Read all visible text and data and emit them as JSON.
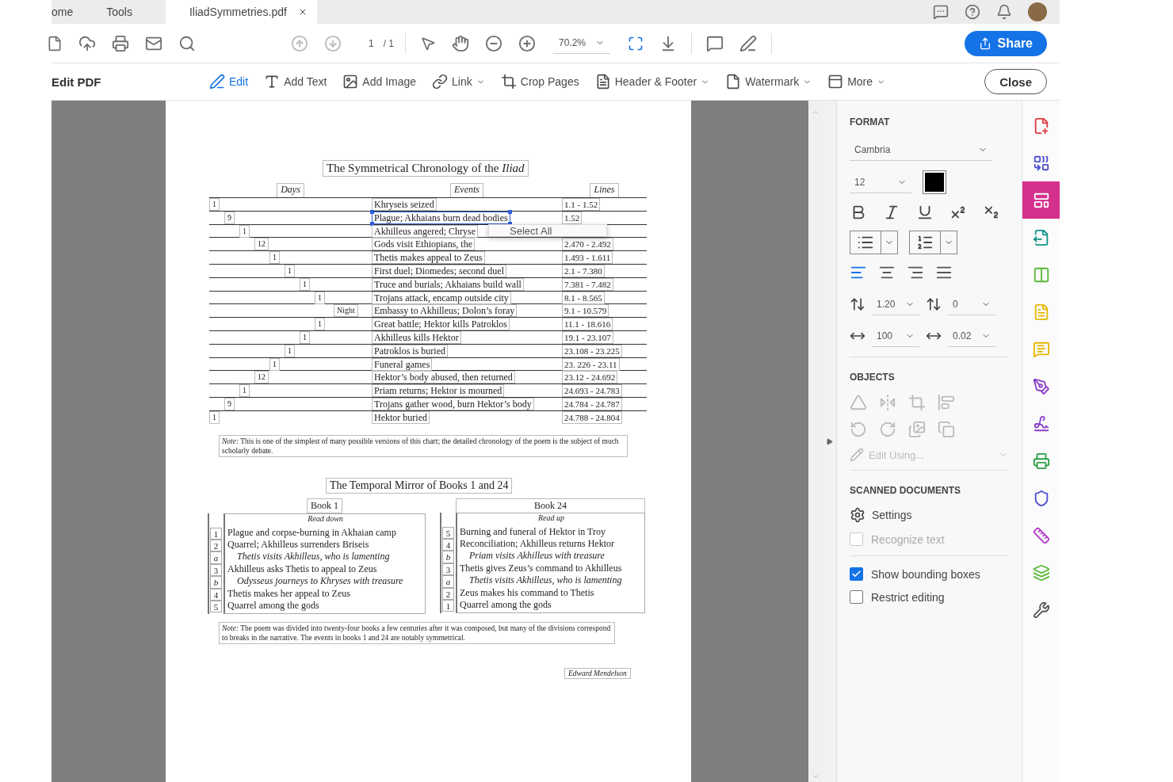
{
  "tabs": [
    {
      "label": "ome",
      "selected": false,
      "closable": false
    },
    {
      "label": "Tools",
      "selected": false,
      "closable": false
    },
    {
      "label": "IliadSymmetries.pdf",
      "selected": true,
      "closable": true
    }
  ],
  "toolbar": {
    "page_current": "1",
    "page_total": "/ 1",
    "zoom": "70.2%",
    "share": "Share"
  },
  "edit_bar": {
    "title": "Edit PDF",
    "tools": [
      {
        "kind": "edit",
        "label": "Edit",
        "selected": true,
        "dropdown": false
      },
      {
        "kind": "text",
        "label": "Add Text",
        "selected": false,
        "dropdown": false
      },
      {
        "kind": "image",
        "label": "Add Image",
        "selected": false,
        "dropdown": false
      },
      {
        "kind": "link",
        "label": "Link",
        "selected": false,
        "dropdown": true
      },
      {
        "kind": "crop",
        "label": "Crop Pages",
        "selected": false,
        "dropdown": false
      },
      {
        "kind": "header",
        "label": "Header & Footer",
        "selected": false,
        "dropdown": true
      },
      {
        "kind": "watermark",
        "label": "Watermark",
        "selected": false,
        "dropdown": true
      },
      {
        "kind": "more",
        "label": "More",
        "selected": false,
        "dropdown": true
      }
    ],
    "close": "Close"
  },
  "document": {
    "title": "The Symmetrical Chronology of the *Iliad*",
    "headers": [
      "Days",
      "Events",
      "Lines"
    ],
    "rows": [
      {
        "days": "1",
        "event": "Khryseis seized",
        "lines": "1.1 - 1.52",
        "selected": false
      },
      {
        "days": "9",
        "event": "Plague; Akhaians burn dead bodies",
        "lines": "1.52",
        "selected": true
      },
      {
        "days": "1",
        "event": "Akhilleus angered; Chryse",
        "selected": false
      },
      {
        "days": "12",
        "event": "Gods visit Ethiopians, the",
        "lines": "2.470 - 2.492",
        "selected": false
      },
      {
        "days": "1",
        "event": "Thetis makes appeal to Zeus",
        "lines": "1.493 - 1.611",
        "selected": false
      },
      {
        "days": "1",
        "event": "First duel; Diomedes; second duel",
        "lines": "2.1 - 7.380",
        "selected": false
      },
      {
        "days": "1",
        "event": "Truce and burials; Akhaians build wall",
        "lines": "7.381 - 7.482",
        "selected": false
      },
      {
        "days": "1",
        "event": "Trojans attack, encamp outside city",
        "lines": "8.1 - 8.565",
        "selected": false
      },
      {
        "days": "Night",
        "event": "Embassy to Akhilleus; Dolon’s foray",
        "lines": "9.1 - 10.579",
        "selected": false
      },
      {
        "days": "1",
        "event": "Great battle; Hektor kills Patroklos",
        "lines": "11.1 - 18.616",
        "selected": false
      },
      {
        "days": "1",
        "event": "Akhilleus kills Hektor",
        "lines": "19.1 - 23.107",
        "selected": false
      },
      {
        "days": "1",
        "event": "Patroklos is buried",
        "lines": "23.108 - 23.225",
        "selected": false
      },
      {
        "days": "1",
        "event": "Funeral games",
        "lines": "23. 226 - 23.11",
        "selected": false
      },
      {
        "days": "12",
        "event": "Hektor’s body abused, then returned",
        "lines": "23.12 - 24.692",
        "selected": false
      },
      {
        "days": "1",
        "event": "Priam returns; Hektor is mourned",
        "lines": "24.693 - 24.783",
        "selected": false
      },
      {
        "days": "9",
        "event": "Trojans gather wood, burn Hektor’s body",
        "lines": "24.784 - 24.787",
        "selected": false
      },
      {
        "days": "1",
        "event": "Hektor buried",
        "lines": "24.788 - 24.804",
        "selected": false
      }
    ],
    "note": "*Note:* This is one of the simplest of many possible versions of this chart; the detailed chronology of the poem is the subject of much scholarly debate.",
    "mirror_title": "The Temporal Mirror of Books 1 and 24",
    "books": [
      {
        "heading": "Book 1",
        "direction": "Read down",
        "items": [
          {
            "mark": "1",
            "text": "Plague and corpse-burning in Akhaian camp",
            "kind": "main"
          },
          {
            "mark": "2",
            "text": "Quarrel; Akhilleus surrenders Briseis",
            "kind": "main"
          },
          {
            "mark": "a",
            "text": "Thetis visits Akhilleus, who is lamenting",
            "kind": "aside"
          },
          {
            "mark": "3",
            "text": "Akhilleus asks Thetis to appeal to Zeus",
            "kind": "main"
          },
          {
            "mark": "b",
            "text": "Odysseus journeys to Khryses with treasure",
            "kind": "aside"
          },
          {
            "mark": "4",
            "text": "Thetis makes her appeal to Zeus",
            "kind": "main"
          },
          {
            "mark": "5",
            "text": "Quarrel among the gods",
            "kind": "main"
          }
        ]
      },
      {
        "heading": "Book 24",
        "direction": "Read up",
        "items": [
          {
            "mark": "5",
            "text": "Burning and funeral of Hektor in Troy",
            "kind": "main"
          },
          {
            "mark": "4",
            "text": "Reconciliation; Akhilleus returns Hektor",
            "kind": "main"
          },
          {
            "mark": "b",
            "text": "Priam visits Akhilleus with treasure",
            "kind": "aside"
          },
          {
            "mark": "3",
            "text": "Thetis gives Zeus’s command to Akhilleus",
            "kind": "main"
          },
          {
            "mark": "a",
            "text": "Thetis visits Akhilleus, who is lamenting",
            "kind": "aside"
          },
          {
            "mark": "2",
            "text": "Zeus makes his command to Thetis",
            "kind": "main"
          },
          {
            "mark": "1",
            "text": "Quarrel among the gods",
            "kind": "main"
          }
        ]
      }
    ],
    "note2": "*Note:* The poem was divided into twenty-four books a few centuries after it was composed, but many of the divisions correspond to breaks in the narrative. The events in books 1 and 24 are notably symmetrical.",
    "author": "Edward Mendelson"
  },
  "context_menu": {
    "items": [
      "Select All"
    ]
  },
  "format_panel": {
    "heading": "FORMAT",
    "font": "Cambria",
    "size": "12",
    "text_styles": [
      {
        "kind": "bold"
      },
      {
        "kind": "italic"
      },
      {
        "kind": "underline"
      },
      {
        "kind": "superscript"
      },
      {
        "kind": "subscript"
      }
    ],
    "alignments": [
      {
        "kind": "left",
        "selected": true
      },
      {
        "kind": "center",
        "selected": false
      },
      {
        "kind": "right",
        "selected": false
      },
      {
        "kind": "justify",
        "selected": false
      }
    ],
    "line_spacing": "1.20",
    "paragraph_spacing": "0",
    "horizontal_scale": "100",
    "char_spacing": "0.02",
    "objects_heading": "OBJECTS",
    "objects_disabled": true,
    "edit_using": "Edit Using...",
    "scanned_heading": "SCANNED DOCUMENTS",
    "settings": "Settings",
    "options": [
      {
        "label": "Recognize text",
        "checked": false,
        "disabled": true
      },
      {
        "label": "Show bounding boxes",
        "checked": true,
        "disabled": false
      },
      {
        "label": "Restrict editing",
        "checked": false,
        "disabled": false
      }
    ]
  },
  "tool_rail": [
    {
      "kind": "create",
      "selected": false
    },
    {
      "kind": "combine",
      "selected": false
    },
    {
      "kind": "organize",
      "selected": true
    },
    {
      "kind": "export",
      "selected": false
    },
    {
      "kind": "compare",
      "selected": false
    },
    {
      "kind": "pdf-note",
      "selected": false
    },
    {
      "kind": "comment",
      "selected": false
    },
    {
      "kind": "fill-sign",
      "selected": false
    },
    {
      "kind": "signature",
      "selected": false
    },
    {
      "kind": "print",
      "selected": false
    },
    {
      "kind": "protect",
      "selected": false
    },
    {
      "kind": "measure",
      "selected": false
    },
    {
      "kind": "stack",
      "selected": false
    },
    {
      "kind": "tools",
      "selected": false
    }
  ]
}
